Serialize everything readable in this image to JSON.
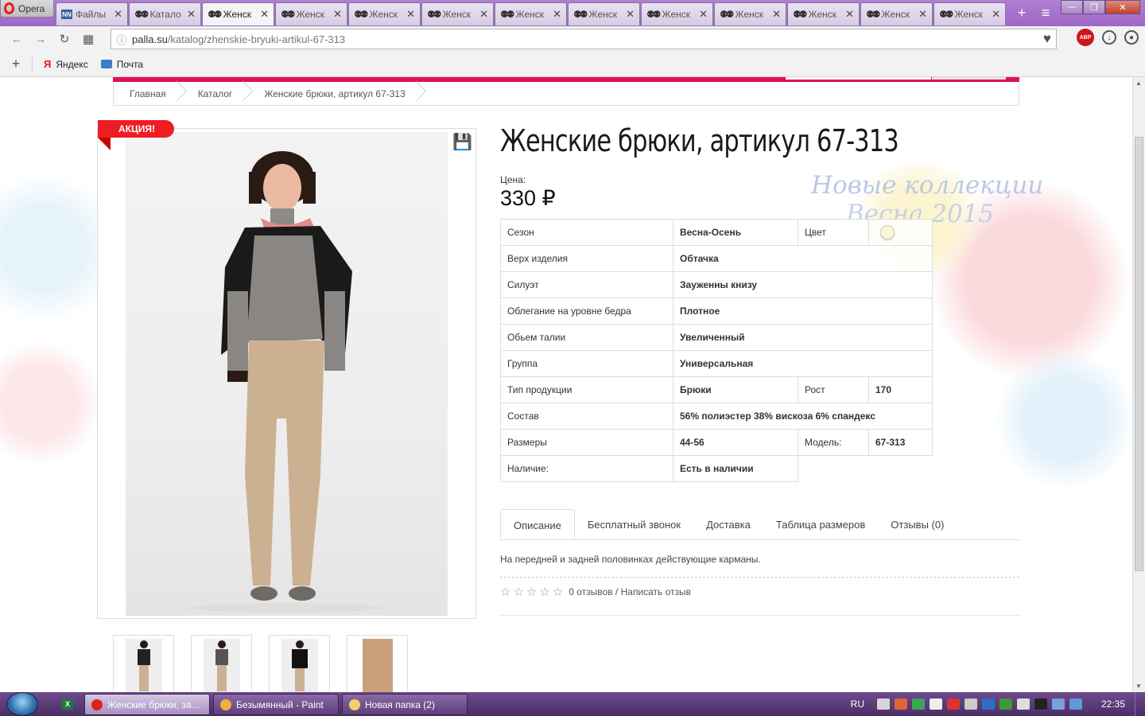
{
  "browser": {
    "menu_label": "Opera",
    "tabs": [
      {
        "title": "Файлы",
        "favicon": "nn-icon"
      },
      {
        "title": "Катало",
        "favicon": "people-icon"
      },
      {
        "title": "Женск",
        "favicon": "people-icon",
        "active": true
      },
      {
        "title": "Женск",
        "favicon": "people-icon"
      },
      {
        "title": "Женск",
        "favicon": "people-icon"
      },
      {
        "title": "Женск",
        "favicon": "people-icon"
      },
      {
        "title": "Женск",
        "favicon": "people-icon"
      },
      {
        "title": "Женск",
        "favicon": "people-icon"
      },
      {
        "title": "Женск",
        "favicon": "people-icon"
      },
      {
        "title": "Женск",
        "favicon": "people-icon"
      },
      {
        "title": "Женск",
        "favicon": "people-icon"
      },
      {
        "title": "Женск",
        "favicon": "people-icon"
      },
      {
        "title": "Женск",
        "favicon": "people-icon"
      }
    ],
    "url_host": "palla.su",
    "url_path": "/katalog/zhenskie-bryuki-artikul-67-313",
    "abp_label": "ABP",
    "bookmarks": [
      {
        "label": "Яндекс",
        "icon": "yandex-icon"
      },
      {
        "label": "Почта",
        "icon": "mail-icon"
      }
    ]
  },
  "breadcrumb": [
    "Главная",
    "Каталог",
    "Женские брюки, артикул 67-313"
  ],
  "product": {
    "sale_badge": "АКЦИЯ!",
    "title": "Женские брюки, артикул 67-313",
    "price_label": "Цена:",
    "price": "330 ₽",
    "watermark_line1": "Новые коллекции",
    "watermark_line2": "Весна 2015",
    "specs": [
      {
        "key": "Сезон",
        "value": "Весна-Осень",
        "key2": "Цвет",
        "value2_color": "#fbf6d4"
      },
      {
        "key": "Верх изделия",
        "value": "Обтачка"
      },
      {
        "key": "Силуэт",
        "value": "Зауженны книзу"
      },
      {
        "key": "Облегание на уровне бедра",
        "value": "Плотное"
      },
      {
        "key": "Обьем талии",
        "value": "Увеличенный"
      },
      {
        "key": "Группа",
        "value": "Универсальная"
      },
      {
        "key": "Тип продукции",
        "value": "Брюки",
        "key2": "Рост",
        "value2": "170"
      },
      {
        "key": "Состав",
        "value": "56% полиэстер 38% вискоза 6% спандекс"
      },
      {
        "key": "Размеры",
        "value": "44-56",
        "key2": "Модель:",
        "value2": "67-313"
      },
      {
        "key": "Наличие:",
        "value": "Есть в наличии"
      }
    ],
    "tabs": [
      "Описание",
      "Бесплатный звонок",
      "Доставка",
      "Таблица размеров",
      "Отзывы (0)"
    ],
    "description": "На передней и задней половинках действующие карманы.",
    "reviews_text": "0 отзывов / Написать отзыв",
    "rating": 0
  },
  "taskbar": {
    "items": [
      {
        "label": "Женские брюки, за...",
        "active": true,
        "icon_color": "#e0201b"
      },
      {
        "label": "Безымянный - Paint",
        "active": false,
        "icon_color": "#f0b23a"
      },
      {
        "label": "Новая папка (2)",
        "active": false,
        "icon_color": "#f3d06b"
      }
    ],
    "lang": "RU",
    "time": "22:35"
  },
  "colors": {
    "header_accent": "#e0124d",
    "sale_red": "#ee1d23",
    "opera_chrome": "#a97bd0"
  }
}
